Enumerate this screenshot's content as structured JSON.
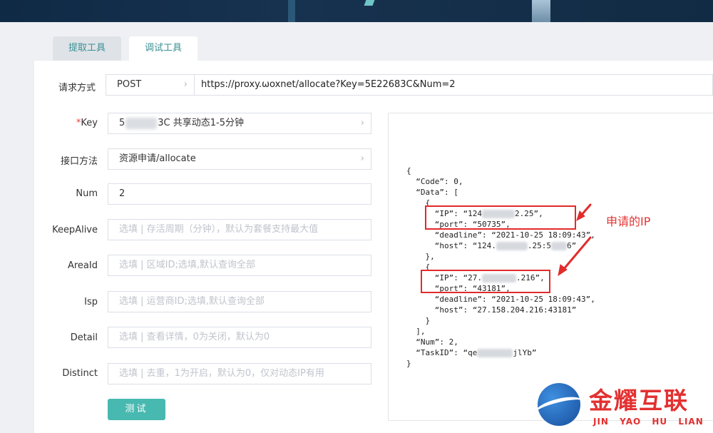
{
  "tabs": [
    {
      "label": "提取工具"
    },
    {
      "label": "调试工具"
    }
  ],
  "request": {
    "label": "请求方式",
    "method": "POST",
    "url": "https://proxy.ωoxnet/allocate?Key=5E22683C&Num=2"
  },
  "form": {
    "key": {
      "label": "Key",
      "required_mark": "*",
      "value_prefix": "5",
      "value_suffix": "3C 共享动态1-5分钟"
    },
    "api_method": {
      "label": "接口方法",
      "value": "资源申请/allocate"
    },
    "num": {
      "label": "Num",
      "value": "2"
    },
    "keepalive": {
      "label": "KeepAlive",
      "placeholder": "选填 | 存活周期（分钟），默认为套餐支持最大值"
    },
    "areaid": {
      "label": "AreaId",
      "placeholder": "选填 | 区域ID;选填,默认查询全部"
    },
    "isp": {
      "label": "Isp",
      "placeholder": "选填 | 运营商ID;选填,默认查询全部"
    },
    "detail": {
      "label": "Detail",
      "placeholder": "选填 | 查看详情，0为关闭，默认为0"
    },
    "distinct": {
      "label": "Distinct",
      "placeholder": "选填 | 去重，1为开启，默认为0，仅对动态IP有用"
    }
  },
  "test_button": "测试",
  "result": {
    "l01": "{",
    "l02": "  “Code”: 0,",
    "l03": "  “Data”: [",
    "l04": "    {",
    "l05a": "      “IP”: “124",
    "l05b": "2.25”,",
    "l06": "      “port”: “50735”,",
    "l07": "      “deadline”: “2021-10-25 18:09:43”,",
    "l08a": "      “host”: “124.",
    "l08b": ".25:5",
    "l08c": "6”",
    "l09": "    },",
    "l10": "    {",
    "l11a": "      “IP”: “27.",
    "l11b": ".216”,",
    "l12": "      “port”: “43181”,",
    "l13": "      “deadline”: “2021-10-25 18:09:43”,",
    "l14": "      “host”: “27.158.204.216:43181”",
    "l15": "    }",
    "l16": "  ],",
    "l17": "  “Num”: 2,",
    "l18a": "  “TaskID”: “qe",
    "l18b": "jlYb”",
    "l19": "}"
  },
  "annotation": "申请的IP",
  "watermark": {
    "cn": "金耀互联",
    "en": "JIN YAO HU LIAN"
  },
  "colors": {
    "accent": "#48b9b0",
    "tab_text": "#3a8f93",
    "highlight": "#e22b2b"
  }
}
